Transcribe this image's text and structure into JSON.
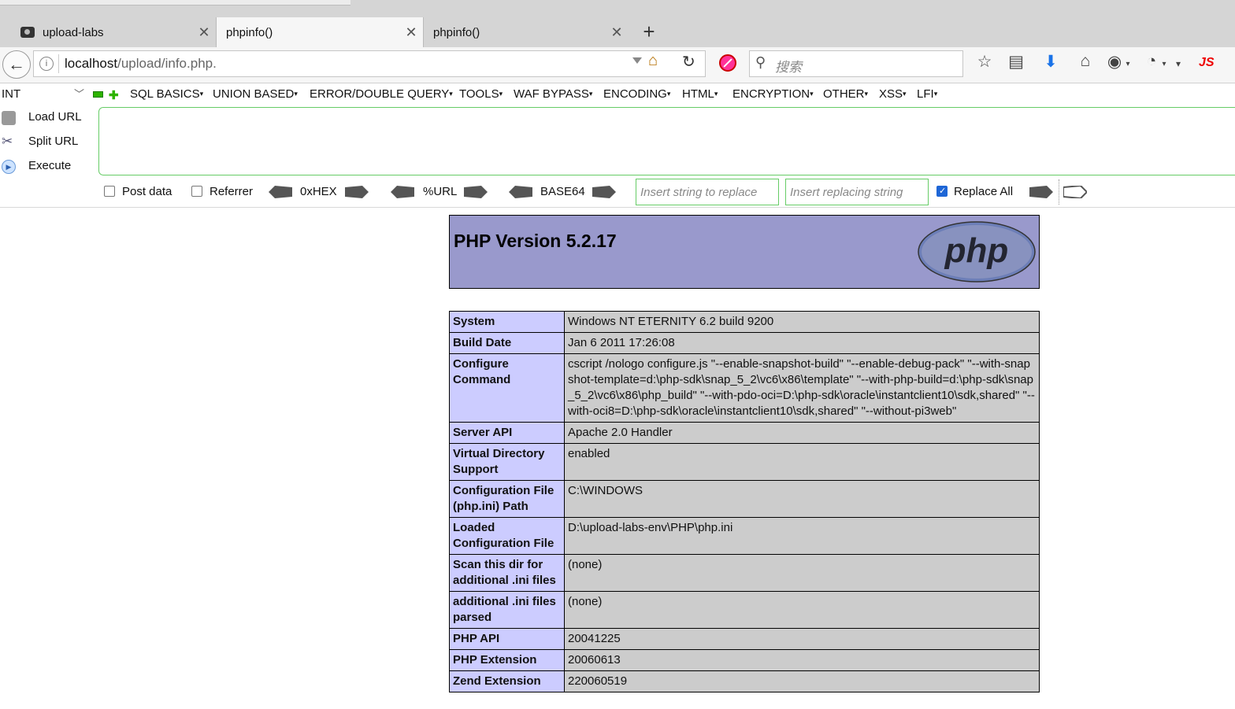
{
  "tabs": [
    {
      "title": "upload-labs",
      "icon": "camera-favicon-icon",
      "active": false
    },
    {
      "title": "phpinfo()",
      "active": true
    },
    {
      "title": "phpinfo()",
      "active": false
    }
  ],
  "navbar": {
    "url_host": "localhost",
    "url_path": "/upload/info.php.",
    "search_placeholder": "搜索",
    "js_label": "JS"
  },
  "hackbar": {
    "type_select": "INT",
    "menus": [
      "SQL BASICS",
      "UNION BASED",
      "ERROR/DOUBLE QUERY",
      "TOOLS",
      "WAF BYPASS",
      "ENCODING",
      "HTML",
      "ENCRYPTION",
      "OTHER",
      "XSS",
      "LFI"
    ],
    "load_url": "Load URL",
    "split_url": "Split URL",
    "execute": "Execute",
    "post_data": "Post data",
    "referrer": "Referrer",
    "hex": "0xHEX",
    "url_enc": "%URL",
    "base64": "BASE64",
    "replace_ph": "Insert string to replace",
    "replacing_ph": "Insert replacing string",
    "replace_all": "Replace All",
    "replace_all_checked": true
  },
  "phpinfo": {
    "version": "PHP Version 5.2.17",
    "logo_text": "php",
    "rows": [
      {
        "k": "System",
        "v": "Windows NT ETERNITY 6.2 build 9200"
      },
      {
        "k": "Build Date",
        "v": "Jan 6 2011 17:26:08"
      },
      {
        "k": "Configure Command",
        "v": "cscript /nologo configure.js \"--enable-snapshot-build\" \"--enable-debug-pack\" \"--with-snapshot-template=d:\\php-sdk\\snap_5_2\\vc6\\x86\\template\" \"--with-php-build=d:\\php-sdk\\snap_5_2\\vc6\\x86\\php_build\" \"--with-pdo-oci=D:\\php-sdk\\oracle\\instantclient10\\sdk,shared\" \"--with-oci8=D:\\php-sdk\\oracle\\instantclient10\\sdk,shared\" \"--without-pi3web\""
      },
      {
        "k": "Server API",
        "v": "Apache 2.0 Handler"
      },
      {
        "k": "Virtual Directory Support",
        "v": "enabled"
      },
      {
        "k": "Configuration File (php.ini) Path",
        "v": "C:\\WINDOWS"
      },
      {
        "k": "Loaded Configuration File",
        "v": "D:\\upload-labs-env\\PHP\\php.ini"
      },
      {
        "k": "Scan this dir for additional .ini files",
        "v": "(none)"
      },
      {
        "k": "additional .ini files parsed",
        "v": "(none)"
      },
      {
        "k": "PHP API",
        "v": "20041225"
      },
      {
        "k": "PHP Extension",
        "v": "20060613"
      },
      {
        "k": "Zend Extension",
        "v": "220060519"
      }
    ]
  }
}
